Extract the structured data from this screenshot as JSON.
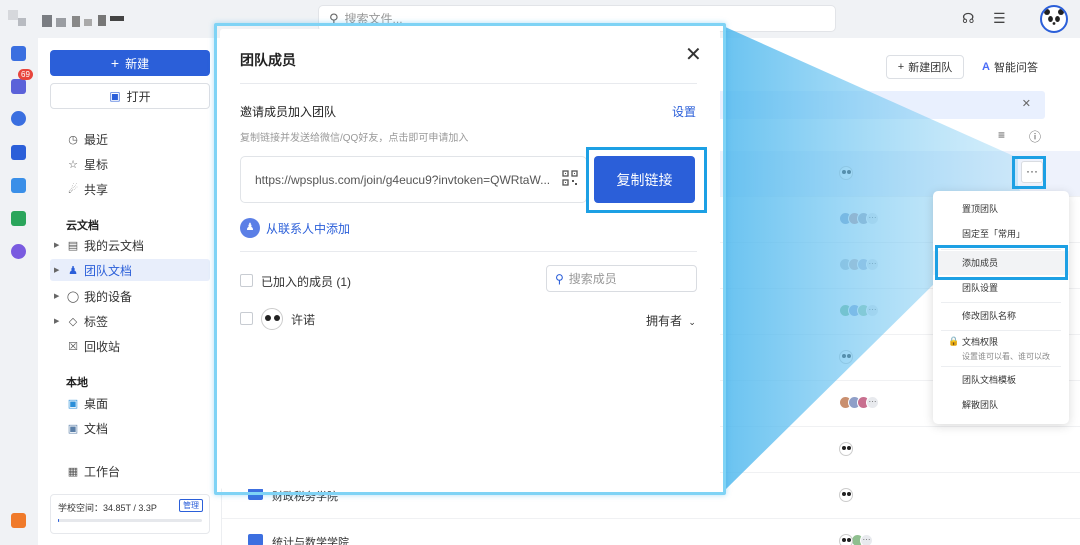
{
  "topbar": {
    "search_placeholder": "搜索文件..."
  },
  "rail": {
    "badge": "69"
  },
  "sidebar": {
    "new_label": "新建",
    "open_label": "打开",
    "items": [
      {
        "label": "最近",
        "icon": "clock-icon"
      },
      {
        "label": "星标",
        "icon": "star-icon"
      },
      {
        "label": "共享",
        "icon": "share-icon"
      }
    ],
    "cloud_section": "云文档",
    "cloud_items": [
      {
        "label": "我的云文档",
        "icon": "folder-icon"
      },
      {
        "label": "团队文档",
        "icon": "team-icon"
      },
      {
        "label": "我的设备",
        "icon": "device-icon"
      },
      {
        "label": "标签",
        "icon": "tag-icon"
      },
      {
        "label": "回收站",
        "icon": "trash-icon"
      }
    ],
    "local_section": "本地",
    "local_items": [
      {
        "label": "桌面",
        "icon": "desktop-icon"
      },
      {
        "label": "文档",
        "icon": "documents-icon"
      }
    ],
    "workbench": "工作台",
    "quota_text": "学校空间：34.85T / 3.3P",
    "quota_manage": "管理",
    "quota_fraction": 0.01
  },
  "main": {
    "new_team": "新建团队",
    "ai_qa": "智能问答",
    "rows": [
      {
        "name": "财政税务学院"
      },
      {
        "name": "统计与数学学院"
      }
    ],
    "more_label": "···"
  },
  "context_menu": {
    "items": [
      "置顶团队",
      "固定至「常用」",
      "添加成员",
      "团队设置",
      "修改团队名称",
      "文档权限",
      "团队文档模板",
      "解散团队"
    ],
    "doc_perm_sub": "设置谁可以看、谁可以改"
  },
  "modal": {
    "title": "团队成员",
    "invite_title": "邀请成员加入团队",
    "settings": "设置",
    "hint": "复制链接并发送给微信/QQ好友，点击即可申请加入",
    "link": "https://wpsplus.com/join/g4eucu9?invtoken=QWRtaW...",
    "copy_btn": "复制链接",
    "add_from_contacts": "从联系人中添加",
    "joined_members": "已加入的成员 (1)",
    "search_member_placeholder": "搜索成员",
    "members": [
      {
        "name": "许诺",
        "role": "拥有者"
      }
    ]
  },
  "colors": {
    "accent": "#2b5fd9",
    "highlight": "#1da0e4",
    "badge": "#e8453c"
  }
}
